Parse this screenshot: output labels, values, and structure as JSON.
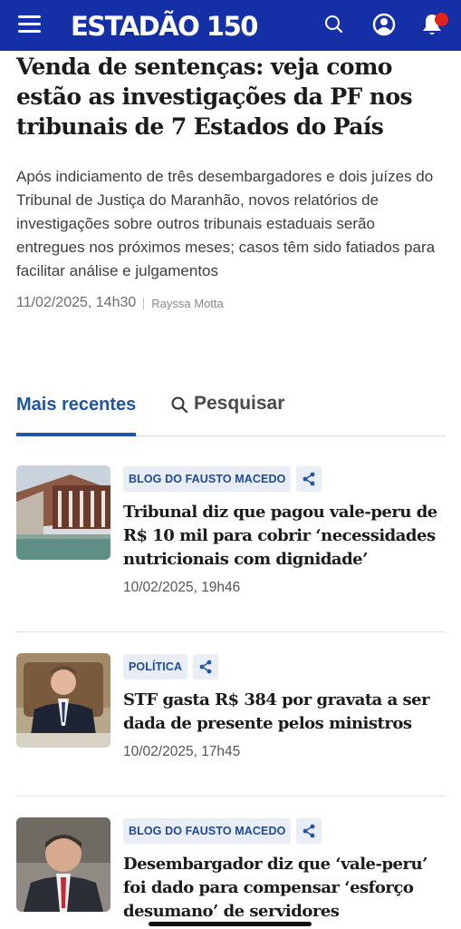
{
  "header": {
    "logo": "ESTADÃO 150",
    "colors": {
      "bar": "#1530a6",
      "notification_dot": "#e3211d"
    },
    "icons": [
      "menu-icon",
      "search-icon",
      "user-icon",
      "bell-icon"
    ]
  },
  "main_article": {
    "title": "Venda de sentenças: veja como estão as investigações da PF nos tribunais de 7 Estados do País",
    "subtitle": "Após indiciamento de três desembargadores e dois juízes do Tribunal de Justiça do Maranhão, novos relatórios de investigações sobre outros tribunais estaduais serão entregues nos próximos meses; casos têm sido fatiados para facilitar análise e julgamentos",
    "date": "11/02/2025, 14h30",
    "author": "Rayssa Motta"
  },
  "tabs": {
    "recent": "Mais recentes",
    "search": "Pesquisar",
    "active": "recent"
  },
  "articles": [
    {
      "tag": "BLOG DO FAUSTO MACEDO",
      "title": "Tribunal diz que pagou vale-peru de R$ 10 mil para cobrir ‘necessidades nutricionais com dignidade’",
      "date": "10/02/2025, 19h46"
    },
    {
      "tag": "POLÍTICA",
      "title": "STF gasta R$ 384 por gravata a ser dada de presente pelos ministros",
      "date": "10/02/2025, 17h45"
    },
    {
      "tag": "BLOG DO FAUSTO MACEDO",
      "title": "Desembargador diz que ‘vale-peru’ foi dado para compensar ‘esforço desumano’ de servidores",
      "date": ""
    }
  ]
}
